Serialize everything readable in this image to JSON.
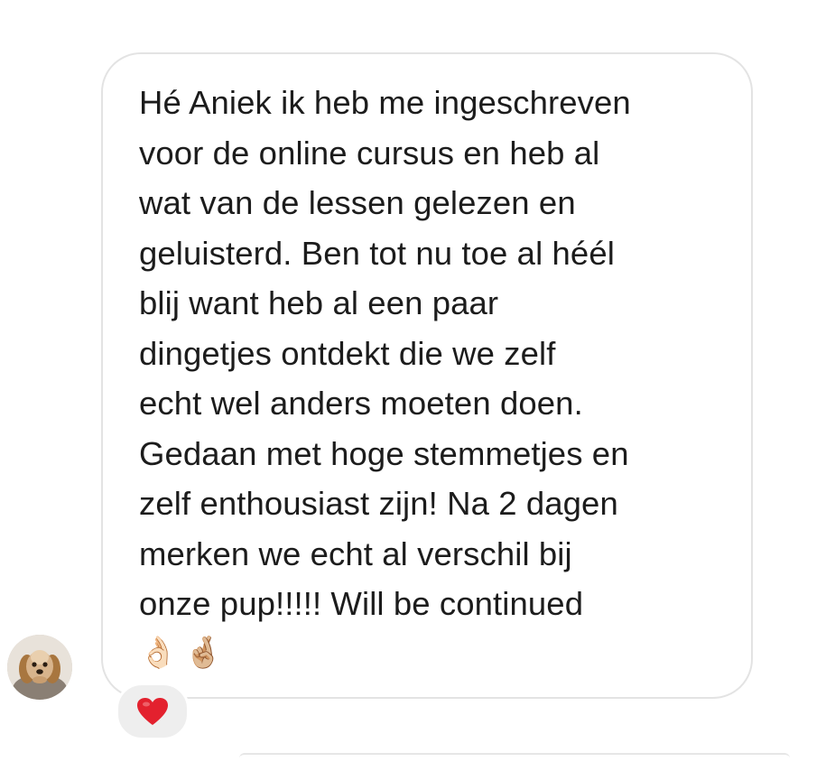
{
  "conversation": {
    "message": {
      "text": "Hé Aniek ik heb me ingeschreven\nvoor de online cursus en heb al\nwat van de lessen gelezen en\ngeluisterd. Ben tot nu toe al héél\nblij want heb al een paar\ndingetjes ontdekt die we zelf\necht wel anders moeten doen.\nGedaan met hoge stemmetjes en\nzelf enthousiast zijn! Na 2 dagen\nmerken we echt al verschil bij\nonze pup!!!!! Will be continued",
      "emojis": [
        "👌🏻",
        "🤞🏼"
      ]
    },
    "reaction": {
      "icon": "red-heart-icon",
      "color": "#e3212e"
    },
    "sender": {
      "avatar_icon": "dog-avatar-icon"
    }
  }
}
